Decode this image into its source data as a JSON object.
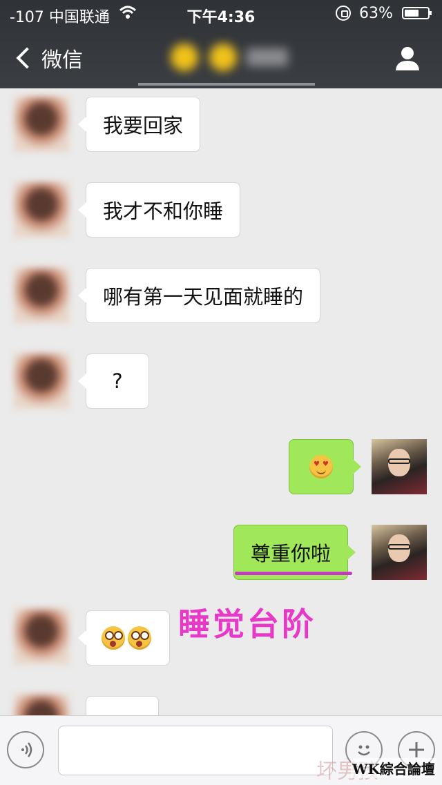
{
  "status_bar": {
    "carrier": "-107 中国联通",
    "time": "下午4:36",
    "battery_pct": "63%",
    "battery_level": 0.63
  },
  "nav": {
    "back_label": "微信"
  },
  "messages": [
    {
      "from": "her",
      "text": "我要回家"
    },
    {
      "from": "her",
      "text": "我才不和你睡"
    },
    {
      "from": "her",
      "text": "哪有第一天见面就睡的"
    },
    {
      "from": "her",
      "text": "?"
    },
    {
      "from": "me",
      "emoji": "heart-eyes-smiley"
    },
    {
      "from": "me",
      "text": "尊重你啦"
    },
    {
      "from": "her",
      "emoji": "shocked-faces"
    }
  ],
  "annotation": "睡觉台阶",
  "watermark": "WK綜合論壇",
  "faint_mark": "坏男孩",
  "colors": {
    "bar": "#34373b",
    "outgoing_bubble": "#a0e75a",
    "annotation": "#e838c8"
  }
}
